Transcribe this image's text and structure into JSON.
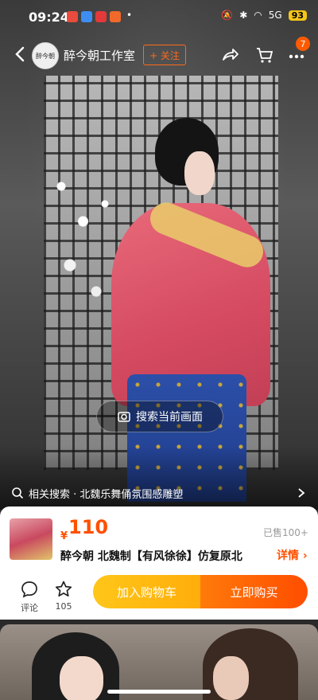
{
  "status_bar": {
    "time": "09:24",
    "network": "5G",
    "battery": "93"
  },
  "nav": {
    "shop_name": "醉今朝工作室",
    "follow_label": "+ 关注",
    "avatar_text": "醉今朝",
    "cart_badge": "7"
  },
  "media": {
    "search_frame_label": "搜索当前画面"
  },
  "related": {
    "text": "相关搜索 · 北魏乐舞俑氛围感雕塑"
  },
  "product": {
    "currency": "¥",
    "price": "110",
    "sold": "已售100+",
    "title": "醉今朝 北魏制【有风徐徐】仿复原北",
    "details_label": "详情"
  },
  "actions": {
    "comment_label": "评论",
    "favorite_count": "105",
    "add_to_cart_label": "加入购物车",
    "buy_now_label": "立即购买"
  },
  "colors": {
    "accent": "#ff5000",
    "cart_button": "#ffb300",
    "buy_button": "#ff5a00"
  }
}
